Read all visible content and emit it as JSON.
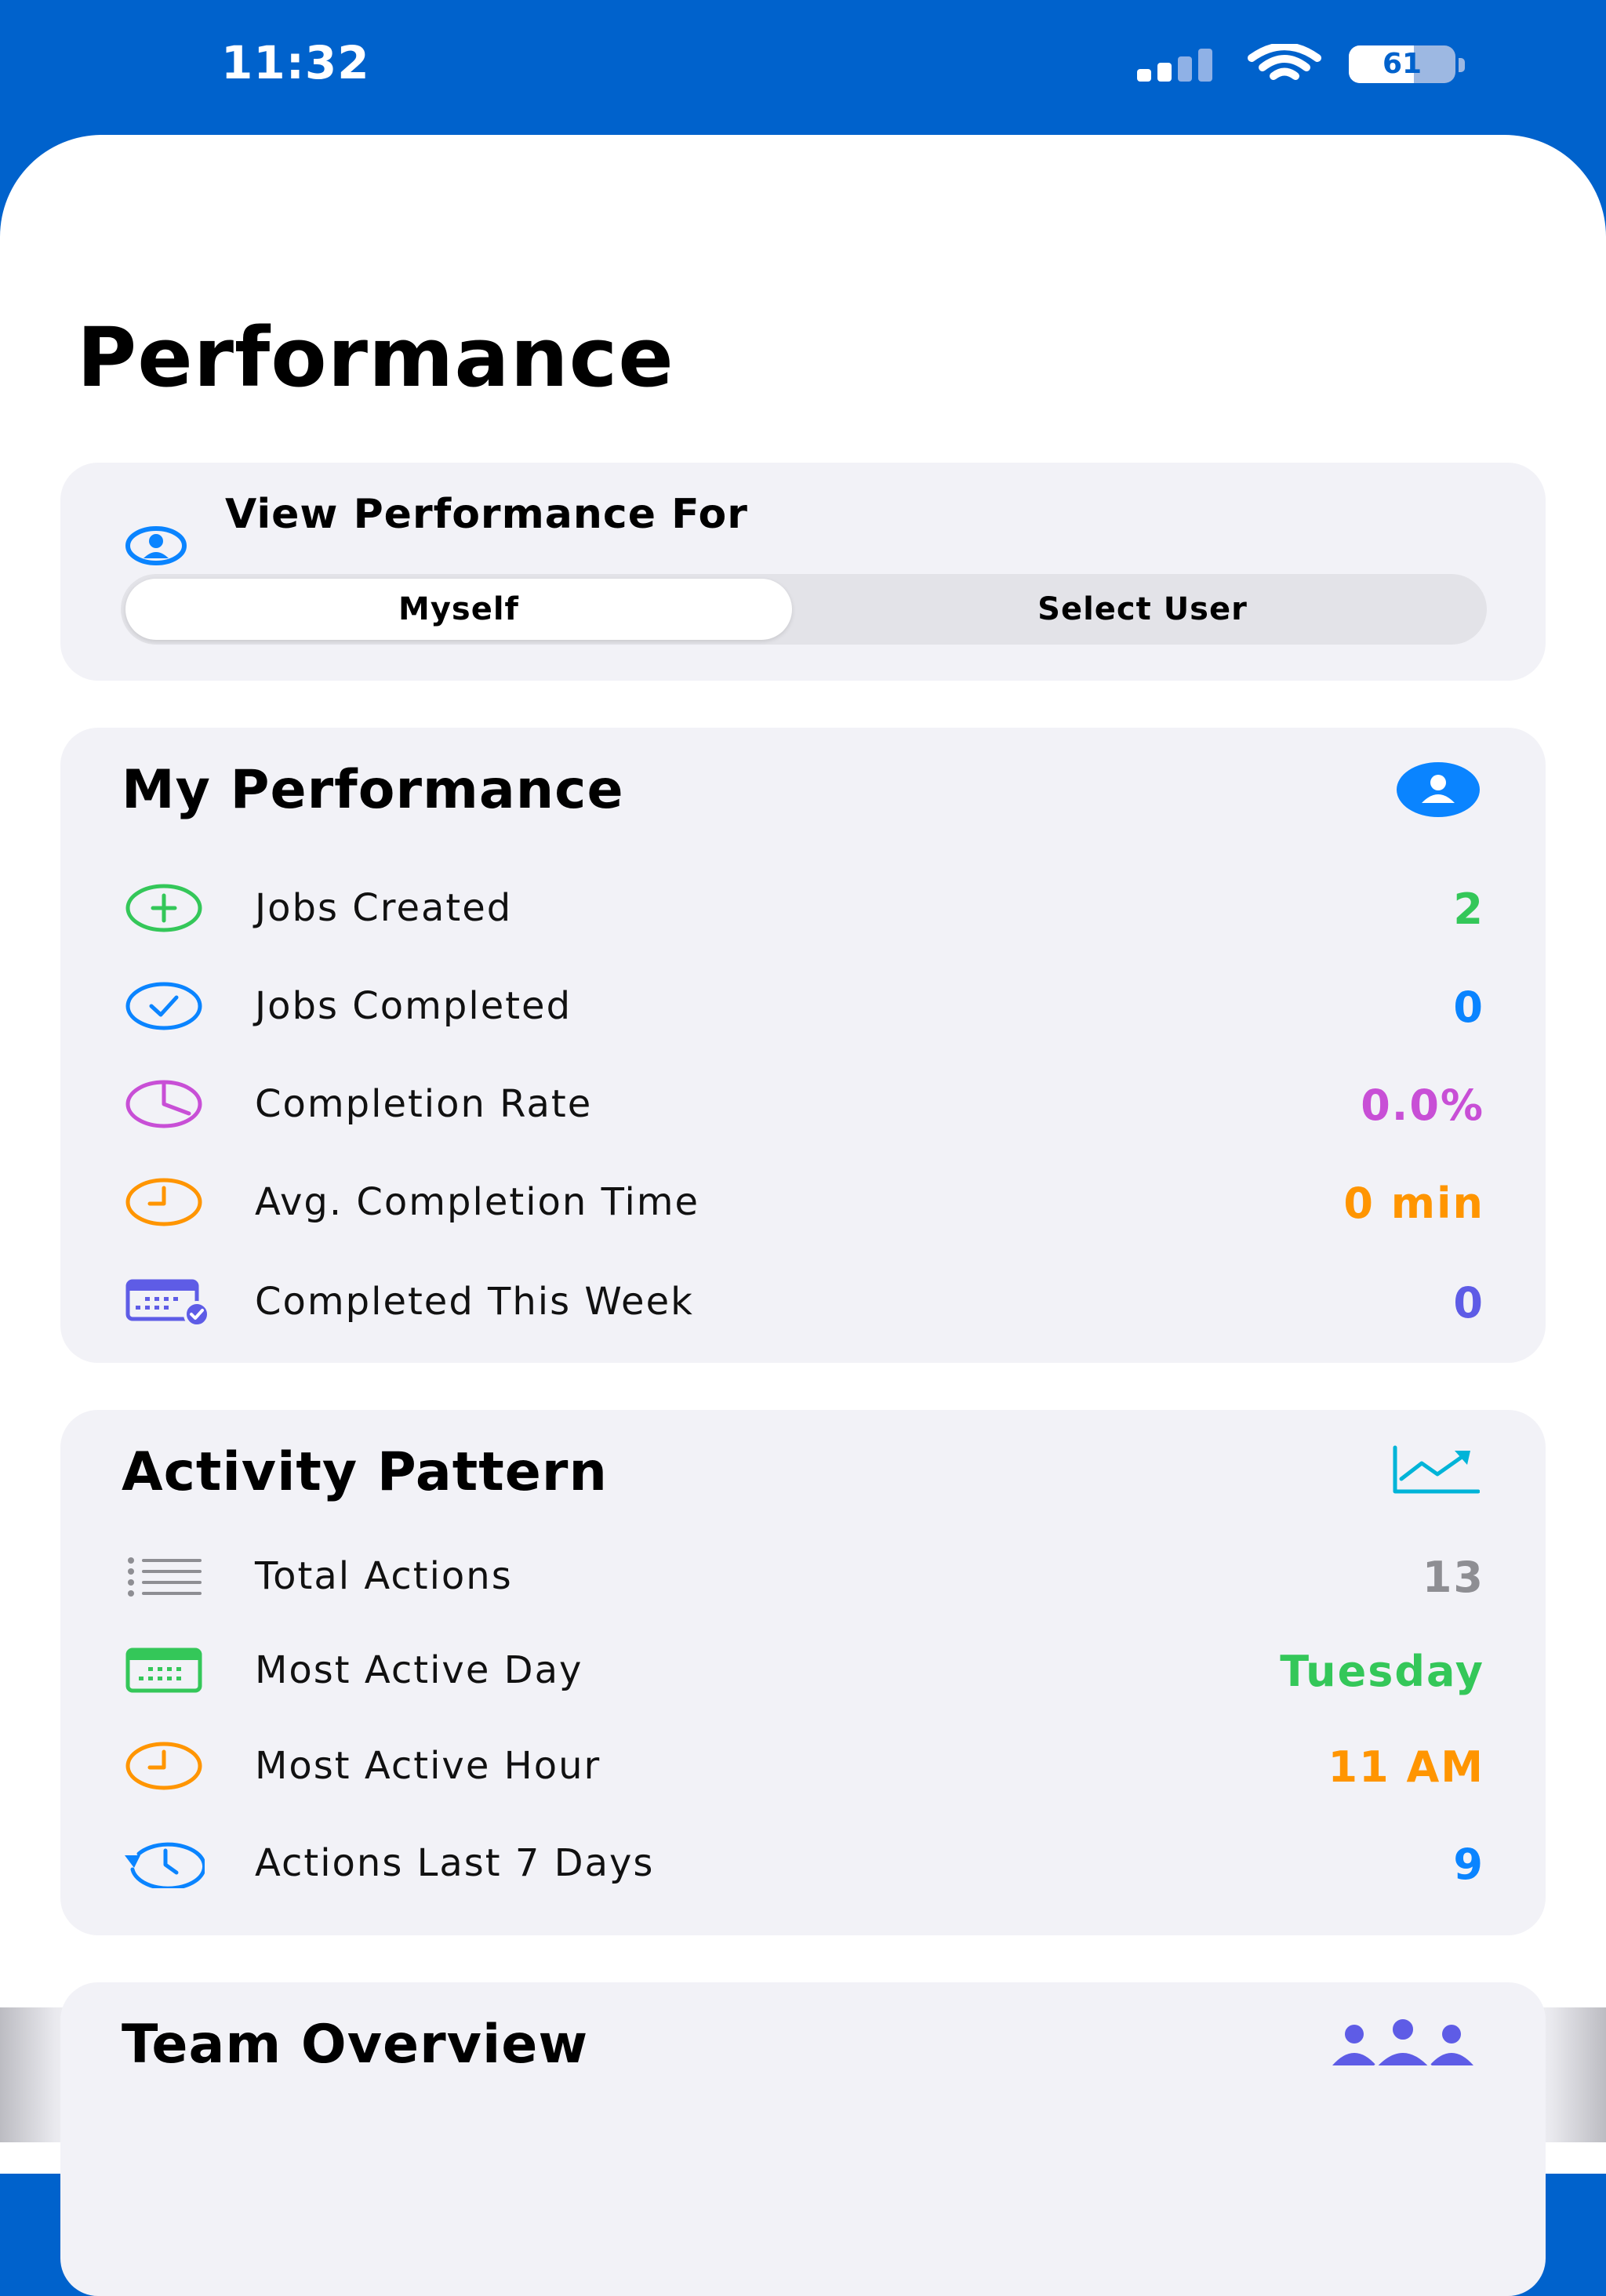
{
  "status_bar": {
    "time": "11:32",
    "battery_level": 61,
    "battery_text": "61"
  },
  "page": {
    "title": "Performance"
  },
  "view_for": {
    "title": "View Performance For",
    "options": [
      "Myself",
      "Select User"
    ],
    "selected": "Myself"
  },
  "my_performance": {
    "title": "My Performance",
    "header_icon": "person-circle-fill-icon",
    "rows": [
      {
        "label": "Jobs Created",
        "value": "2",
        "icon": "plus-circle-icon",
        "color": "#34c759"
      },
      {
        "label": "Jobs Completed",
        "value": "0",
        "icon": "checkmark-circle-icon",
        "color": "#0a84ff"
      },
      {
        "label": "Completion Rate",
        "value": "0.0%",
        "icon": "chart-pie-icon",
        "color": "#c84fd6"
      },
      {
        "label": "Avg. Completion Time",
        "value": "0 min",
        "icon": "clock-icon",
        "color": "#ff9500"
      },
      {
        "label": "Completed This Week",
        "value": "0",
        "icon": "calendar-badge-checkmark-icon",
        "color": "#5e5ce6"
      }
    ]
  },
  "activity_pattern": {
    "title": "Activity Pattern",
    "header_icon": "chart-line-uptrend-icon",
    "rows": [
      {
        "label": "Total Actions",
        "value": "13",
        "icon": "list-bullet-icon",
        "color": "#8e8e93"
      },
      {
        "label": "Most Active Day",
        "value": "Tuesday",
        "icon": "calendar-icon",
        "color": "#34c759"
      },
      {
        "label": "Most Active Hour",
        "value": "11 AM",
        "icon": "clock-icon",
        "color": "#ff9500"
      },
      {
        "label": "Actions Last 7 Days",
        "value": "9",
        "icon": "clock-arrow-circlepath-icon",
        "color": "#0a84ff"
      }
    ]
  },
  "team_overview": {
    "title": "Team Overview",
    "header_icon": "person-3-fill-icon"
  }
}
